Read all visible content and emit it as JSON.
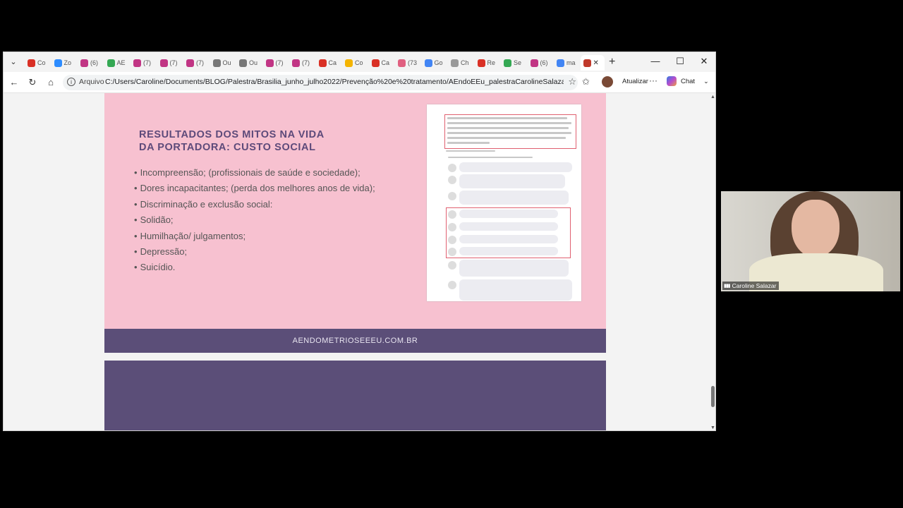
{
  "browser": {
    "tabs": [
      {
        "label": "Co",
        "icon": "gmail-icon",
        "color": "#d93025"
      },
      {
        "label": "Zo",
        "icon": "zoom-icon",
        "color": "#2d8cff"
      },
      {
        "label": "(6)",
        "icon": "instagram-icon",
        "color": "#c13584"
      },
      {
        "label": "AE",
        "icon": "drive-icon",
        "color": "#34a853"
      },
      {
        "label": "(7)",
        "icon": "instagram-icon",
        "color": "#c13584"
      },
      {
        "label": "(7)",
        "icon": "instagram-icon",
        "color": "#c13584"
      },
      {
        "label": "(7)",
        "icon": "instagram-icon",
        "color": "#c13584"
      },
      {
        "label": "Ou",
        "icon": "circle-icon",
        "color": "#777777"
      },
      {
        "label": "Ou",
        "icon": "circle-icon",
        "color": "#777777"
      },
      {
        "label": "(7)",
        "icon": "instagram-icon",
        "color": "#c13584"
      },
      {
        "label": "(7)",
        "icon": "instagram-icon",
        "color": "#c13584"
      },
      {
        "label": "Ca",
        "icon": "gmail-icon",
        "color": "#d93025"
      },
      {
        "label": "Co",
        "icon": "pencil-icon",
        "color": "#f4b400"
      },
      {
        "label": "Ca",
        "icon": "gmail-icon",
        "color": "#d93025"
      },
      {
        "label": "(73",
        "icon": "youtube-icon",
        "color": "#e06080"
      },
      {
        "label": "Go",
        "icon": "translate-icon",
        "color": "#4285f4"
      },
      {
        "label": "Ch",
        "icon": "chatgpt-icon",
        "color": "#999999"
      },
      {
        "label": "Re",
        "icon": "gmail-icon",
        "color": "#d93025"
      },
      {
        "label": "Se",
        "icon": "star-icon",
        "color": "#34a853"
      },
      {
        "label": "(6)",
        "icon": "instagram-icon",
        "color": "#c13584"
      },
      {
        "label": "ma",
        "icon": "google-icon",
        "color": "#4285f4"
      }
    ],
    "active_tab": {
      "icon": "pdf-icon",
      "color": "#c0392b"
    },
    "new_tab": "+",
    "controls": {
      "minimize": "—",
      "maximize": "☐",
      "close": "✕"
    },
    "scheme_label": "Arquivo",
    "url": "C:/Users/Caroline/Documents/BLOG/Palestra/Brasilia_junho_julho2022/Prevenção%20e%20tratamento/AEndoEEu_palestraCarolineSalazar_...",
    "update_label": "Atualizar",
    "chat_label": "Chat"
  },
  "slide": {
    "title_line1": "RESULTADOS DOS MITOS NA VIDA",
    "title_line2": "DA PORTADORA: CUSTO SOCIAL",
    "bullets": [
      "Incompreensão;  (profissionais de saúde e sociedade);",
      "Dores incapacitantes; (perda dos melhores anos de vida);",
      "Discriminação e exclusão social:",
      "Solidão;",
      "Humilhação/ julgamentos;",
      "Depressão;",
      "Suicídio."
    ],
    "footer_text": "AENDOMETRIOSEEEU.COM.BR"
  },
  "webcam": {
    "participant_name": "Caroline Salazar"
  },
  "colors": {
    "slide_bg": "#f7c1d0",
    "title": "#5d4a7a",
    "footer_bg": "#5b4e78"
  }
}
